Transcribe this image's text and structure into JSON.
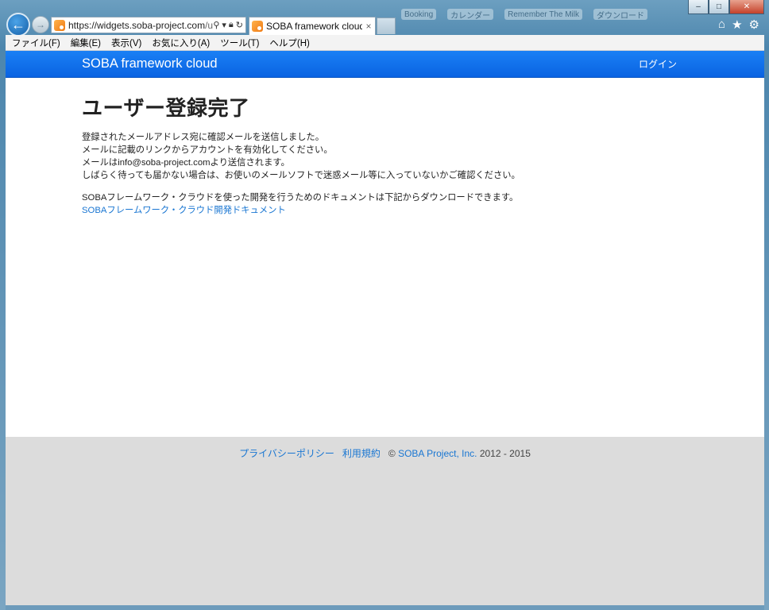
{
  "browser": {
    "url_host": "https://widgets.soba-project.com",
    "url_rest": "/u",
    "tab_title": "SOBA framework cloud",
    "tab_close": "×",
    "bookmark_hints": [
      "Booking",
      "カレンダー",
      "Remember The Milk",
      "ダウンロード"
    ],
    "window_buttons": {
      "minimize": "–",
      "maximize": "□",
      "close": "✕"
    }
  },
  "menu": {
    "items": [
      "ファイル(F)",
      "編集(E)",
      "表示(V)",
      "お気に入り(A)",
      "ツール(T)",
      "ヘルプ(H)"
    ]
  },
  "navbar": {
    "brand": "SOBA framework cloud",
    "login": "ログイン"
  },
  "main": {
    "title": "ユーザー登録完了",
    "lines": [
      "登録されたメールアドレス宛に確認メールを送信しました。",
      "メールに記載のリンクからアカウントを有効化してください。",
      "メールはinfo@soba-project.comより送信されます。",
      "しばらく待っても届かない場合は、お使いのメールソフトで迷惑メール等に入っていないかご確認ください。"
    ],
    "doc_note": "SOBAフレームワーク・クラウドを使った開発を行うためのドキュメントは下記からダウンロードできます。",
    "doc_link": "SOBAフレームワーク・クラウド開発ドキュメント"
  },
  "footer": {
    "privacy": "プライバシーポリシー",
    "terms": "利用規約",
    "copyright_prefix": "©",
    "company": "SOBA Project, Inc.",
    "years": "2012 - 2015"
  }
}
